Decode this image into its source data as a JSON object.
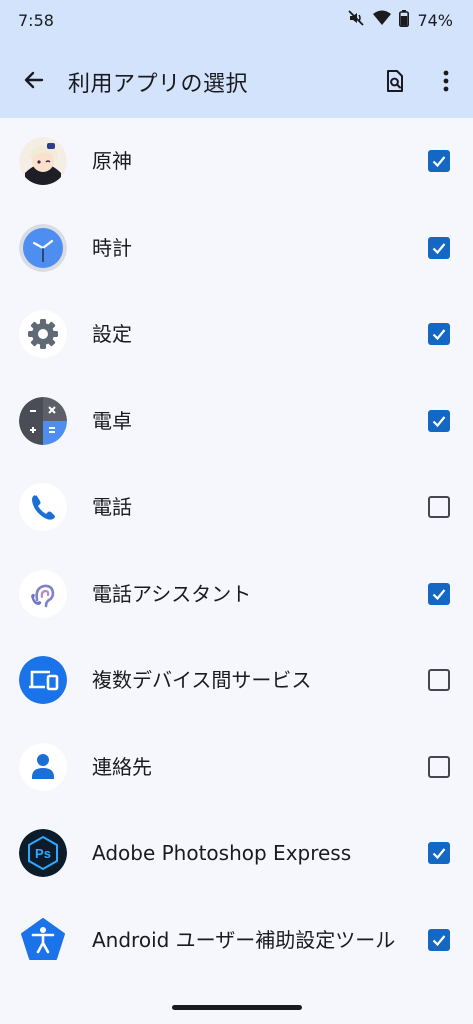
{
  "status": {
    "time": "7:58",
    "battery": "74%"
  },
  "appbar": {
    "title": "利用アプリの選択"
  },
  "colors": {
    "header_bg": "#d3e3fb",
    "page_bg": "#f6f7fc",
    "checkbox_on": "#1468c4"
  },
  "apps": [
    {
      "label": "原神",
      "icon": "genshin-icon",
      "checked": true
    },
    {
      "label": "時計",
      "icon": "clock-icon",
      "checked": true
    },
    {
      "label": "設定",
      "icon": "settings-gear-icon",
      "checked": true
    },
    {
      "label": "電卓",
      "icon": "calculator-icon",
      "checked": true
    },
    {
      "label": "電話",
      "icon": "phone-icon",
      "checked": false
    },
    {
      "label": "電話アシスタント",
      "icon": "phone-assistant-icon",
      "checked": true
    },
    {
      "label": "複数デバイス間サービス",
      "icon": "cross-device-icon",
      "checked": false
    },
    {
      "label": "連絡先",
      "icon": "contacts-icon",
      "checked": false
    },
    {
      "label": "Adobe Photoshop Express",
      "icon": "photoshop-express-icon",
      "checked": true
    },
    {
      "label": "Android ユーザー補助設定ツール",
      "icon": "accessibility-icon",
      "checked": true
    }
  ]
}
